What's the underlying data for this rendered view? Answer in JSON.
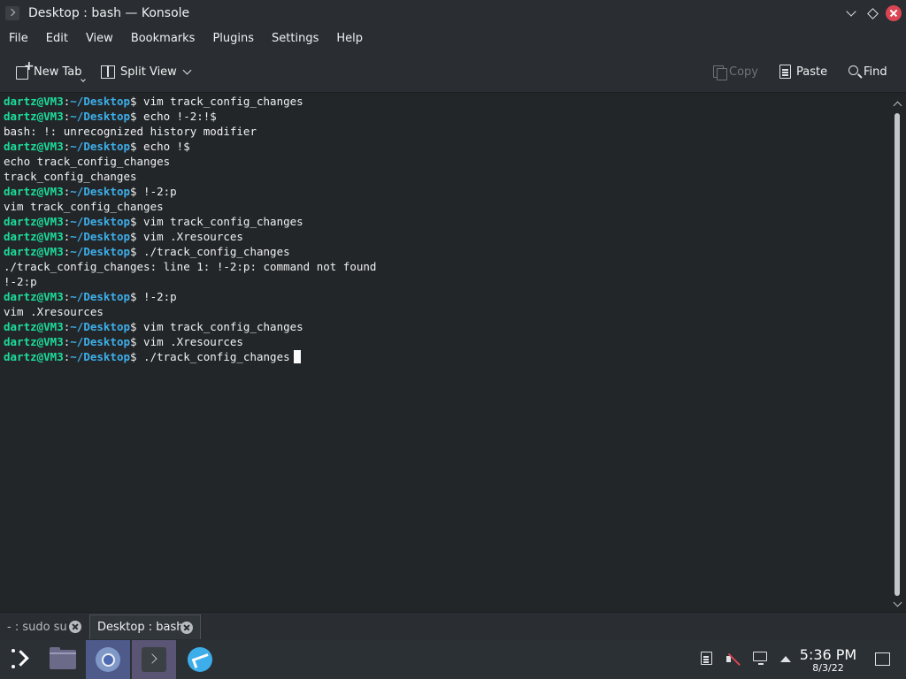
{
  "window": {
    "title": "Desktop : bash — Konsole"
  },
  "menu": [
    "File",
    "Edit",
    "View",
    "Bookmarks",
    "Plugins",
    "Settings",
    "Help"
  ],
  "toolbar": {
    "new_tab": "New Tab",
    "split_view": "Split View",
    "copy": "Copy",
    "paste": "Paste",
    "find": "Find"
  },
  "terminal": {
    "prompt_user": "dartz@VM3",
    "prompt_sep": ":",
    "prompt_path": "~/Desktop",
    "prompt_end": "$ ",
    "lines": [
      {
        "type": "prompt",
        "cmd": "vim track_config_changes"
      },
      {
        "type": "prompt",
        "cmd": "echo !-2:!$"
      },
      {
        "type": "output",
        "text": "bash: !: unrecognized history modifier"
      },
      {
        "type": "prompt",
        "cmd": "echo !$"
      },
      {
        "type": "output",
        "text": "echo track_config_changes"
      },
      {
        "type": "output",
        "text": "track_config_changes"
      },
      {
        "type": "prompt",
        "cmd": "!-2:p"
      },
      {
        "type": "output",
        "text": "vim track_config_changes"
      },
      {
        "type": "prompt",
        "cmd": "vim track_config_changes"
      },
      {
        "type": "prompt",
        "cmd": "vim .Xresources"
      },
      {
        "type": "prompt",
        "cmd": "./track_config_changes"
      },
      {
        "type": "output",
        "text": "./track_config_changes: line 1: !-2:p: command not found"
      },
      {
        "type": "output",
        "text": "!-2:p"
      },
      {
        "type": "prompt",
        "cmd": "!-2:p"
      },
      {
        "type": "output",
        "text": "vim .Xresources"
      },
      {
        "type": "prompt",
        "cmd": "vim track_config_changes"
      },
      {
        "type": "prompt",
        "cmd": "vim .Xresources"
      },
      {
        "type": "prompt",
        "cmd": "./track_config_changes",
        "cursor": true
      }
    ]
  },
  "tabs": [
    {
      "label": "- : sudo su",
      "active": false
    },
    {
      "label": "Desktop : bash",
      "active": true
    }
  ],
  "taskbar": {
    "clock_time": "5:36 PM",
    "clock_date": "8/3/22",
    "apps": [
      "application-launcher",
      "file-manager",
      "chromium",
      "konsole",
      "kde-connect"
    ]
  },
  "colors": {
    "prompt_user": "#1cdc9a",
    "prompt_path": "#3daee9",
    "background": "#232629",
    "close_button": "#da4453"
  }
}
